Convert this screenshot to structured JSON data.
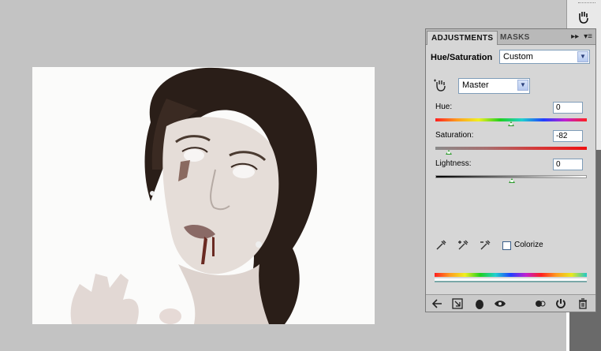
{
  "panel": {
    "tabs": [
      "ADJUSTMENTS",
      "MASKS"
    ],
    "tabbar_icons": [
      "▸▸",
      "▾≡"
    ],
    "title": "Hue/Saturation",
    "preset": "Custom",
    "channel": "Master",
    "hue": {
      "label": "Hue:",
      "value": "0",
      "level": 0.5
    },
    "saturation": {
      "label": "Saturation:",
      "value": "-82",
      "level": 0.09
    },
    "lightness": {
      "label": "Lightness:",
      "value": "0",
      "level": 0.5
    },
    "colorize_label": "Colorize",
    "colorize_checked": false
  },
  "icons": {
    "hand": "targeted-adjustment-hand-icon",
    "eyedropper": "eyedropper-icon",
    "eyedropper_plus": "eyedropper-plus-icon",
    "eyedropper_minus": "eyedropper-minus-icon",
    "footer": [
      "back-arrow-icon",
      "expand-view-icon",
      "clip-layer-icon",
      "visibility-eye-icon",
      "previous-state-icon",
      "reset-icon",
      "trash-icon"
    ]
  },
  "colors": {
    "canvas_bg": "#c3c3c3",
    "panel_bg": "#d6d6d6",
    "slider_thumb": "#2b9a2b"
  }
}
